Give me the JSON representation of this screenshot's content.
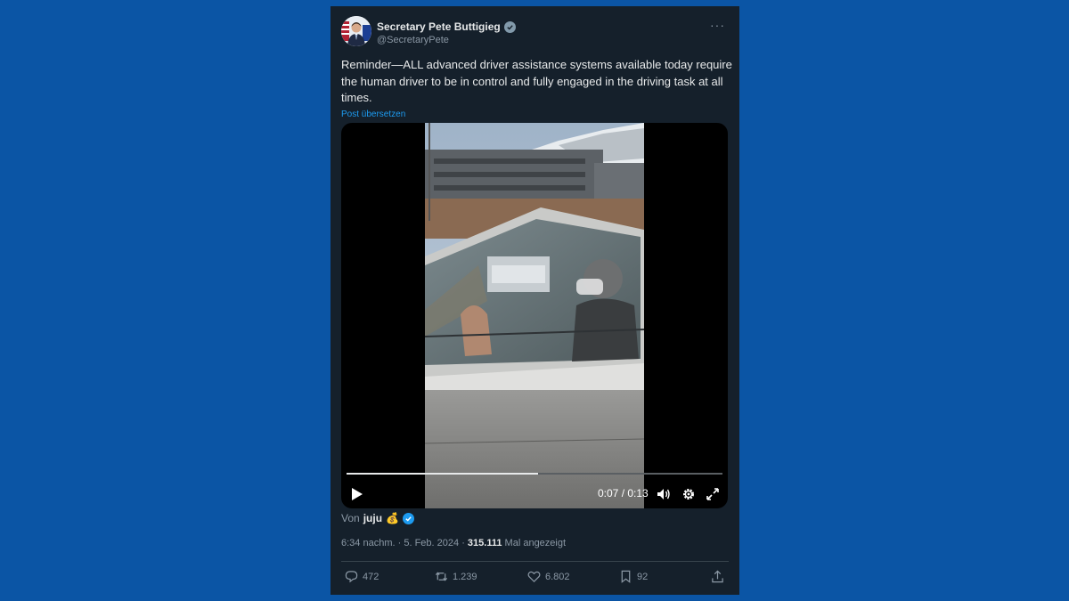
{
  "author": {
    "name": "Secretary Pete Buttigieg",
    "handle": "@SecretaryPete"
  },
  "post": {
    "text": "Reminder—ALL advanced driver assistance systems available today require the human driver to be in control and fully engaged in the driving task at all times.",
    "translate_label": "Post übersetzen"
  },
  "video": {
    "time_label": "0:07 / 0:13",
    "progress": 0.51
  },
  "attribution": {
    "prefix": "Von",
    "user": "juju",
    "emoji": "💰"
  },
  "meta": {
    "time": "6:34 nachm.",
    "date": "5. Feb. 2024",
    "views": "315.111",
    "views_label": "Mal angezeigt"
  },
  "actions": {
    "replies": "472",
    "reposts": "1.239",
    "likes": "6.802",
    "bookmarks": "92"
  },
  "colors": {
    "background": "#0b55a5",
    "card": "#15202b",
    "accent": "#1d9bf0"
  }
}
